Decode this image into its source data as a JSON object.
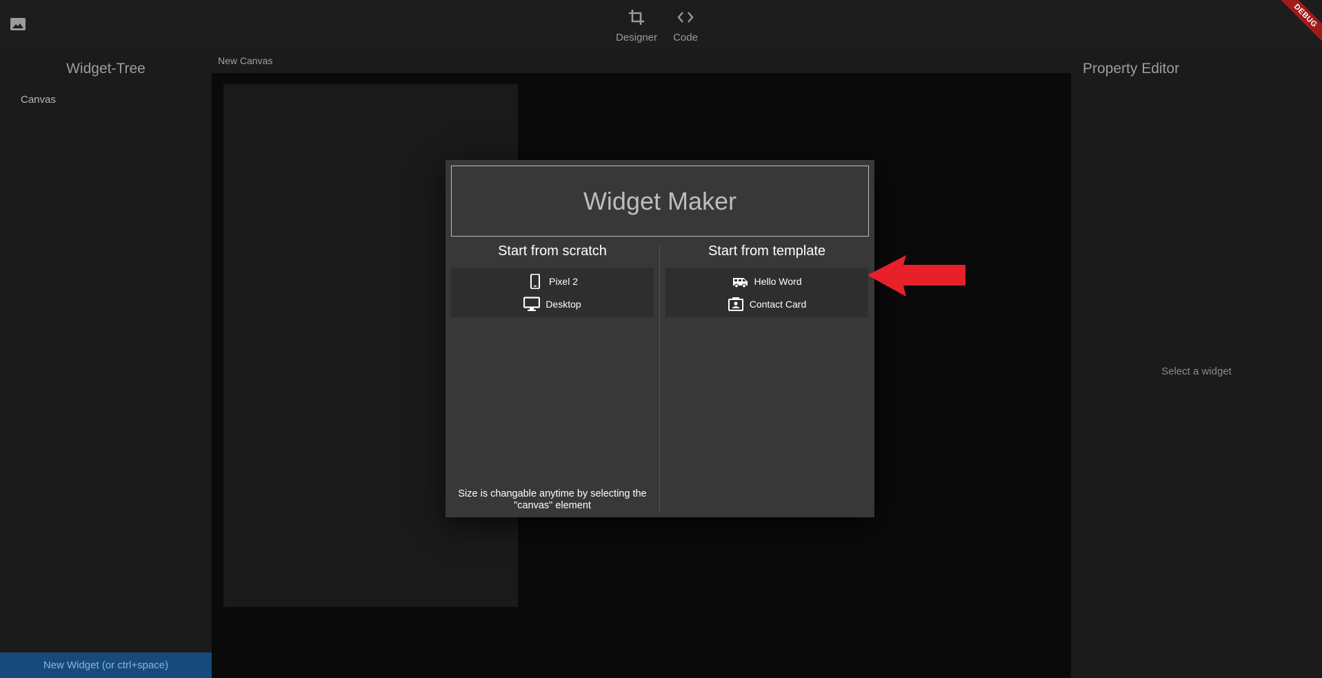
{
  "topbar": {
    "nav": [
      {
        "label": "Designer",
        "icon": "crop-icon"
      },
      {
        "label": "Code",
        "icon": "code-icon"
      }
    ],
    "debug_label": "DEBUG"
  },
  "left_panel": {
    "title": "Widget-Tree",
    "tree_items": [
      "Canvas"
    ],
    "new_widget_label": "New Widget (or ctrl+space)"
  },
  "center": {
    "canvas_name": "New Canvas"
  },
  "right_panel": {
    "title": "Property Editor",
    "empty_hint": "Select a widget"
  },
  "dialog": {
    "title": "Widget Maker",
    "scratch": {
      "title": "Start from scratch",
      "options": [
        {
          "label": "Pixel 2",
          "icon": "phone-icon"
        },
        {
          "label": "Desktop",
          "icon": "monitor-icon"
        }
      ],
      "note": "Size is changable anytime by selecting the \"canvas\" element"
    },
    "template": {
      "title": "Start from template",
      "options": [
        {
          "label": "Hello Word",
          "icon": "van-icon"
        },
        {
          "label": "Contact Card",
          "icon": "contact-card-icon"
        }
      ]
    }
  },
  "colors": {
    "accent_blue": "#174a7c",
    "arrow_red": "#e8202a",
    "debug_red": "#a11b1b"
  }
}
